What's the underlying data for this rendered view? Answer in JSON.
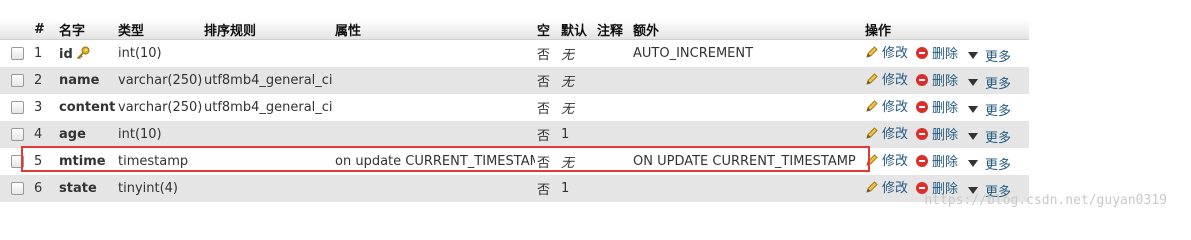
{
  "headers": {
    "num": "#",
    "name": "名字",
    "type": "类型",
    "collation": "排序规则",
    "attributes": "属性",
    "null": "空",
    "default": "默认",
    "comment": "注释",
    "extra": "额外",
    "action": "操作"
  },
  "actions": {
    "edit": "修改",
    "drop": "删除",
    "more": "更多"
  },
  "rows": [
    {
      "num": "1",
      "name": "id",
      "type": "int(10)",
      "collation": "",
      "attributes": "",
      "null": "否",
      "default": "无",
      "comment": "",
      "extra": "AUTO_INCREMENT",
      "primary_key": true
    },
    {
      "num": "2",
      "name": "name",
      "type": "varchar(250)",
      "collation": "utf8mb4_general_ci",
      "attributes": "",
      "null": "否",
      "default": "无",
      "comment": "",
      "extra": ""
    },
    {
      "num": "3",
      "name": "content",
      "type": "varchar(250)",
      "collation": "utf8mb4_general_ci",
      "attributes": "",
      "null": "否",
      "default": "无",
      "comment": "",
      "extra": ""
    },
    {
      "num": "4",
      "name": "age",
      "type": "int(10)",
      "collation": "",
      "attributes": "",
      "null": "否",
      "default": "1",
      "comment": "",
      "extra": ""
    },
    {
      "num": "5",
      "name": "mtime",
      "type": "timestamp",
      "collation": "",
      "attributes": "on update CURRENT_TIMESTAMP",
      "null": "否",
      "default": "无",
      "comment": "",
      "extra": "ON UPDATE CURRENT_TIMESTAMP"
    },
    {
      "num": "6",
      "name": "state",
      "type": "tinyint(4)",
      "collation": "",
      "attributes": "",
      "null": "否",
      "default": "1",
      "comment": "",
      "extra": ""
    }
  ],
  "watermark": "https://blog.csdn.net/guyan0319",
  "colors": {
    "highlight": "#e53935",
    "link": "#235a81",
    "drop": "#d9302c"
  }
}
